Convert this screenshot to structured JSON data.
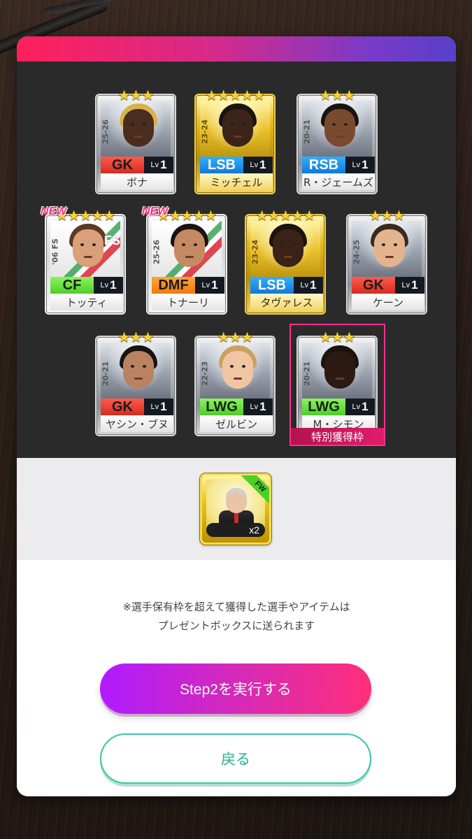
{
  "players": [
    {
      "position": "GK",
      "level_prefix": "Lv",
      "level": "1",
      "name": "ボナ",
      "season": "25-26",
      "stars": "★★★",
      "variant": "silver",
      "pos_class": "gk",
      "new": ""
    },
    {
      "position": "LSB",
      "level_prefix": "Lv",
      "level": "1",
      "name": "ミッチェル",
      "season": "23-24",
      "stars": "★★★★★",
      "variant": "gold",
      "pos_class": "df",
      "new": ""
    },
    {
      "position": "RSB",
      "level_prefix": "Lv",
      "level": "1",
      "name": "R・ジェームズ",
      "season": "20-21",
      "stars": "★★★",
      "variant": "silver",
      "pos_class": "df",
      "new": ""
    },
    {
      "position": "CF",
      "level_prefix": "Lv",
      "level": "1",
      "name": "トッティ",
      "season": "'06 FS",
      "stars": "★★★★★",
      "variant": "special",
      "pos_class": "fw",
      "new": "NEW",
      "fs": "FS"
    },
    {
      "position": "DMF",
      "level_prefix": "Lv",
      "level": "1",
      "name": "トナーリ",
      "season": "25-26",
      "stars": "★★★★★",
      "variant": "special",
      "pos_class": "mf",
      "new": "NEW"
    },
    {
      "position": "LSB",
      "level_prefix": "Lv",
      "level": "1",
      "name": "タヴァレス",
      "season": "23-24",
      "stars": "★★★★★",
      "variant": "gold",
      "pos_class": "df",
      "new": ""
    },
    {
      "position": "GK",
      "level_prefix": "Lv",
      "level": "1",
      "name": "ケーン",
      "season": "24-25",
      "stars": "★★★",
      "variant": "silver",
      "pos_class": "gk",
      "new": ""
    },
    {
      "position": "GK",
      "level_prefix": "Lv",
      "level": "1",
      "name": "ヤシン・ブヌ",
      "season": "20-21",
      "stars": "★★★",
      "variant": "silver",
      "pos_class": "gk",
      "new": ""
    },
    {
      "position": "LWG",
      "level_prefix": "Lv",
      "level": "1",
      "name": "ゼルビン",
      "season": "22-23",
      "stars": "★★★",
      "variant": "silver",
      "pos_class": "fw",
      "new": ""
    },
    {
      "position": "LWG",
      "level_prefix": "Lv",
      "level": "1",
      "name": "M・シモン",
      "season": "20-21",
      "stars": "★★★",
      "variant": "silver",
      "pos_class": "fw",
      "new": ""
    }
  ],
  "special_slot_label": "特別獲得枠",
  "item": {
    "tag": "FW",
    "count": "x2"
  },
  "notice": {
    "line1": "※選手保有枠を超えて獲得した選手やアイテムは",
    "line2": "プレゼントボックスに送られます"
  },
  "buttons": {
    "execute": "Step2を実行する",
    "back": "戻る"
  },
  "colors": {
    "accent_gradient_start": "#b01bff",
    "accent_gradient_end": "#ff2f7a",
    "secondary": "#35c9a2",
    "special_frame": "#ff2d8e"
  }
}
